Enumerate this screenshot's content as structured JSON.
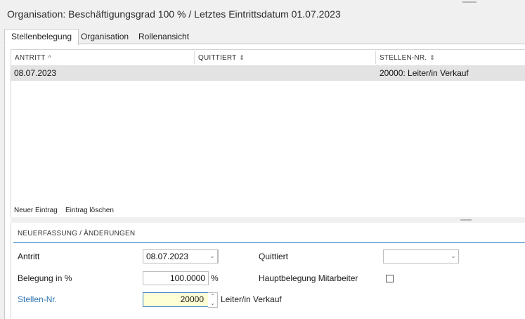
{
  "window": {
    "title": "Organisation: Beschäftigungsgrad 100 % / Letztes Eintrittsdatum 01.07.2023"
  },
  "tabs": [
    {
      "label": "Stellenbelegung",
      "active": true
    },
    {
      "label": "Organisation",
      "active": false
    },
    {
      "label": "Rollenansicht",
      "active": false
    }
  ],
  "grid": {
    "columns": [
      {
        "label": "ANTRITT",
        "sort_icon": "^"
      },
      {
        "label": "QUITTIERT",
        "sort_icon": "⇕"
      },
      {
        "label": "STELLEN-NR.",
        "sort_icon": "⇕"
      }
    ],
    "rows": [
      {
        "antritt": "08.07.2023",
        "quittiert": "",
        "stellen_nr": "20000: Leiter/in Verkauf"
      }
    ]
  },
  "toolbar": {
    "new_entry": "Neuer Eintrag",
    "delete_entry": "Eintrag löschen"
  },
  "form": {
    "section_title": "NEUERFASSUNG / ÄNDERUNGEN",
    "antritt": {
      "label": "Antritt",
      "value": "08.07.2023"
    },
    "quittiert": {
      "label": "Quittiert",
      "value": ""
    },
    "belegung": {
      "label": "Belegung in %",
      "value": "100.0000",
      "unit": "%"
    },
    "hauptbelegung": {
      "label": "Hauptbelegung Mitarbeiter",
      "checked": false
    },
    "stellen_nr": {
      "label": "Stellen-Nr.",
      "value": "20000",
      "description": "Leiter/in Verkauf"
    }
  },
  "icons": {
    "dropdown": "chevron-down-icon",
    "spin_up": "chevron-up-icon",
    "spin_down": "chevron-down-icon"
  },
  "colors": {
    "accent": "#3c82c8",
    "link_label": "#2e74b5",
    "selected_row": "#e3e3e3",
    "highlighted_input": "#ffffd6"
  }
}
